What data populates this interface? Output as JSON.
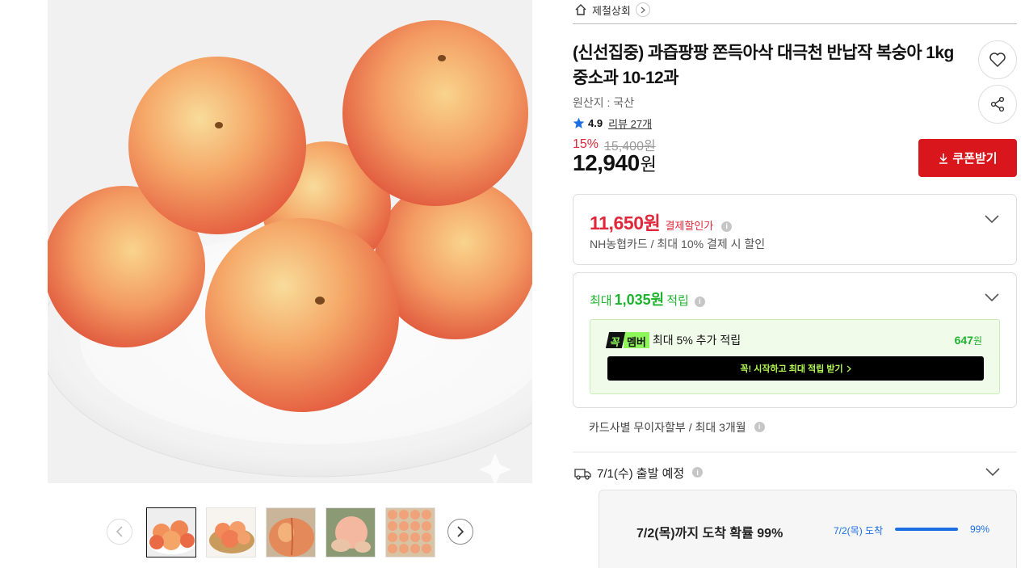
{
  "store": {
    "name": "제철상회",
    "icon": "home-icon"
  },
  "product": {
    "title": "(신선집중) 과즙팡팡 쫀득아삭 대극천 반납작 복숭아 1kg 중소과 10-12과",
    "origin": "원산지 : 국산",
    "rating": "4.9",
    "reviews": "리뷰 27개",
    "discount_pct": "15%",
    "original_price": "15,400원",
    "price": "12,940",
    "price_unit": "원"
  },
  "coupon_button": {
    "label": "쿠폰받기"
  },
  "card_discount": {
    "price": "11,650원",
    "label": "결제할인가",
    "desc": "NH농협카드 / 최대 10% 결제 시 할인"
  },
  "points": {
    "prefix": "최대",
    "amount": "1,035원",
    "suffix": "적립",
    "member_badge_k": "꼭",
    "member_badge_m": "멤버",
    "member_desc": "최대 5% 추가 적립",
    "member_amount": "647",
    "member_amount_unit": "원",
    "cta": "꼭! 시작하고 최대 적립 받기"
  },
  "installment": "카드사별 무이자할부 / 최대 3개월",
  "shipping": {
    "departure": "7/1(수) 출발 예정",
    "arrival_text": "7/2(목)까지 도착 확률 99%",
    "arrival_date": "7/2(목) 도착",
    "arrival_pct": "99%",
    "arrival_fraction": 0.99
  },
  "gallery": {
    "thumb_count": 5,
    "active_index": 0
  },
  "colors": {
    "accent_red": "#d8161b",
    "discount_red": "#e0283a",
    "points_green": "#1db32e",
    "member_lime": "#8ef55a",
    "shipping_blue": "#1b6fe3"
  }
}
